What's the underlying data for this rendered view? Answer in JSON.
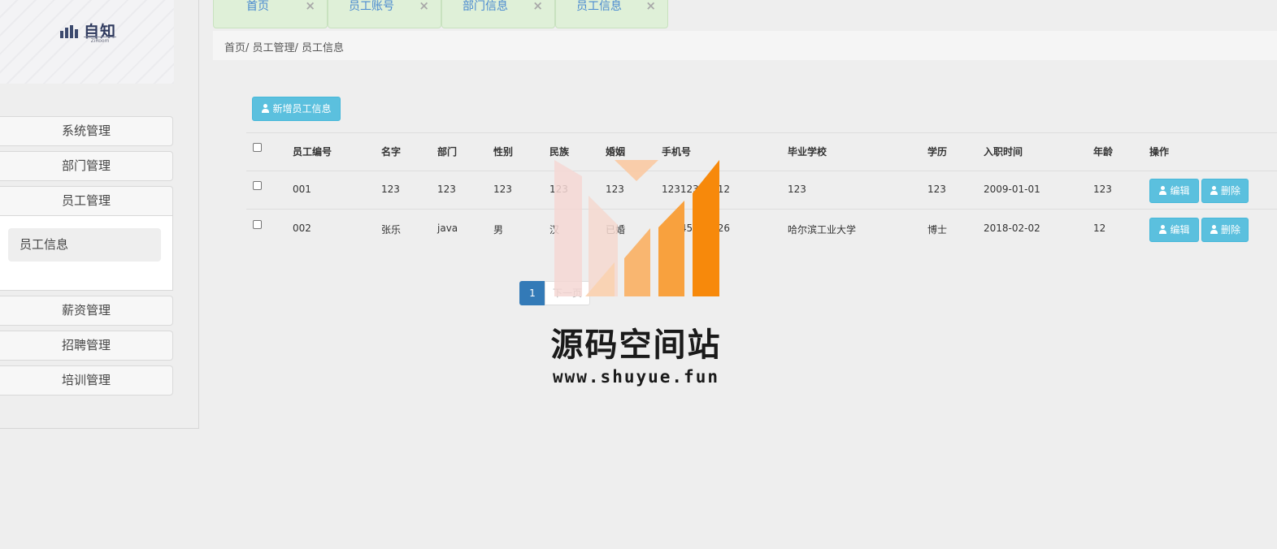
{
  "logo": {
    "text": "自知",
    "subtext": "ZiRoom"
  },
  "sidebar": {
    "items": [
      {
        "label": "系统管理"
      },
      {
        "label": "部门管理"
      },
      {
        "label": "员工管理"
      },
      {
        "label": "薪资管理"
      },
      {
        "label": "招聘管理"
      },
      {
        "label": "培训管理"
      }
    ],
    "submenu": {
      "label": "员工信息"
    }
  },
  "tabs": [
    {
      "label": "首页",
      "close": "×"
    },
    {
      "label": "员工账号",
      "close": "×"
    },
    {
      "label": "部门信息",
      "close": "×"
    },
    {
      "label": "员工信息",
      "close": "×"
    }
  ],
  "breadcrumb": "首页/ 员工管理/ 员工信息",
  "toolbar": {
    "add_label": "新增员工信息"
  },
  "table": {
    "headers": [
      "员工编号",
      "名字",
      "部门",
      "性别",
      "民族",
      "婚姻",
      "手机号",
      "毕业学校",
      "学历",
      "入职时间",
      "年龄",
      "操作"
    ],
    "rows": [
      {
        "id": "001",
        "name": "123",
        "dept": "123",
        "gender": "123",
        "ethnic": "123",
        "marriage": "123",
        "phone": "12312312312",
        "school": "123",
        "degree": "123",
        "hire_date": "2009-01-01",
        "age": "123"
      },
      {
        "id": "002",
        "name": "张乐",
        "dept": "java",
        "gender": "男",
        "ethnic": "汉",
        "marriage": "已婚",
        "phone": "15245263526",
        "school": "哈尔滨工业大学",
        "degree": "博士",
        "hire_date": "2018-02-02",
        "age": "12"
      }
    ],
    "edit_label": "编辑",
    "delete_label": "删除"
  },
  "pagination": {
    "current": "1",
    "next": "下一页"
  },
  "watermark": {
    "title": "源码空间站",
    "url": "www.shuyue.fun"
  },
  "colors": {
    "accent": "#5bc0de",
    "tab_bg": "#dff0d8",
    "page_active": "#337ab7",
    "watermark_orange": "#f7890b"
  }
}
